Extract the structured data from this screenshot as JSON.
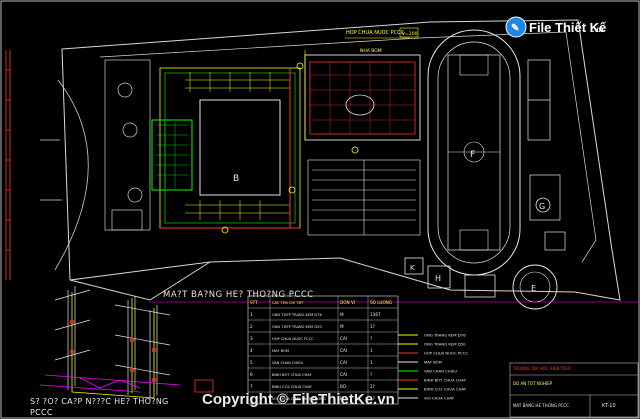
{
  "watermark": {
    "brand": "File Thiết Kế",
    "brand_suffix": ".vn",
    "copyright": "Copyright © FileThietKe.vn"
  },
  "plan": {
    "title": "MA?T BA?NG HE? THO?NG PCCC",
    "tag_top": "HOP CHUA NUOC PCCC",
    "tag_top_value": "V=200",
    "tag_pump": "NHA BOM",
    "zones": [
      "B",
      "F",
      "G",
      "E",
      "H",
      "K"
    ]
  },
  "schematic": {
    "title": "S? ?O? CA?P N???C HE? THO?NG PCCC"
  },
  "legend_table": {
    "headers": [
      "STT",
      "CAC TEN CHI TIET",
      "DON VI",
      "SO LUONG"
    ],
    "rows": [
      [
        "1",
        "ONG THEP TRANG KEM D76",
        "M",
        "1367"
      ],
      [
        "2",
        "ONG THEP TRANG KEM D50",
        "M",
        "1?"
      ],
      [
        "3",
        "HOP CHUA NUOC PCCC",
        "CAI",
        "?"
      ],
      [
        "4",
        "MAY BOM",
        "CAI",
        "1"
      ],
      [
        "5",
        "VAN CHAN CHIEU",
        "CAI",
        "1"
      ],
      [
        "6",
        "BINH BOT CHUA CHAY",
        "CAI",
        "?"
      ],
      [
        "7",
        "BINH CO2 CHUA CHAY",
        "BO",
        "2?"
      ],
      [
        "8",
        "VOI CHUA CHAY VACH TUONG",
        "BO",
        "1?"
      ]
    ]
  },
  "symbols": {
    "rows": [
      "ONG TRANG KEM D76",
      "ONG TRANG KEM D50",
      "HOP CHUA NUOC PCCC",
      "MAY BOM",
      "VAN CHAN CHIEU",
      "BINH BOT CHUA CHAY",
      "BINH CO2 CHUA CHAY",
      "VOI CHUA CHAY"
    ]
  },
  "title_block": {
    "line1": "TRUONG DAI HOC KIEN TRUC",
    "line2": "DO AN TOT NGHIEP",
    "drawing": "MAT BANG HE THONG PCCC",
    "sheet": "KT-10"
  },
  "colors": {
    "background": "#000000",
    "frame": "#c8c8c8",
    "line_white": "#e6e6e6",
    "line_yellow": "#ffff00",
    "line_red": "#ff3030",
    "line_green": "#00ff00",
    "line_magenta": "#ff00ff",
    "text_yellow": "#ffff33"
  }
}
